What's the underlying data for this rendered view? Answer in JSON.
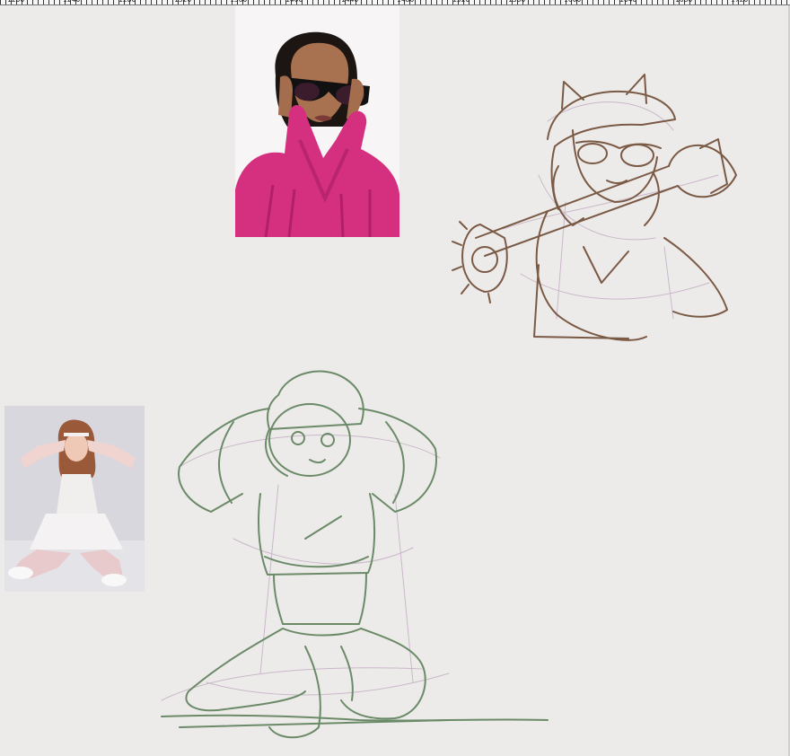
{
  "ruler": {
    "labels": [
      "1200",
      "1240",
      "1280",
      "1320",
      "1360",
      "1400",
      "1440",
      "1480",
      "1520",
      "1560",
      "1600",
      "1640",
      "1680",
      "1720",
      "1760"
    ]
  },
  "canvas": {
    "background": "#edebea"
  },
  "references": [
    {
      "id": "sunglasses-woman-photo",
      "description": ""
    },
    {
      "id": "white-dress-woman-photo",
      "description": ""
    }
  ],
  "sketch_colors": {
    "brown_ink": "#7a5a45",
    "green_ink": "#6b8a68",
    "construction_lines": "#c9b7c9"
  }
}
